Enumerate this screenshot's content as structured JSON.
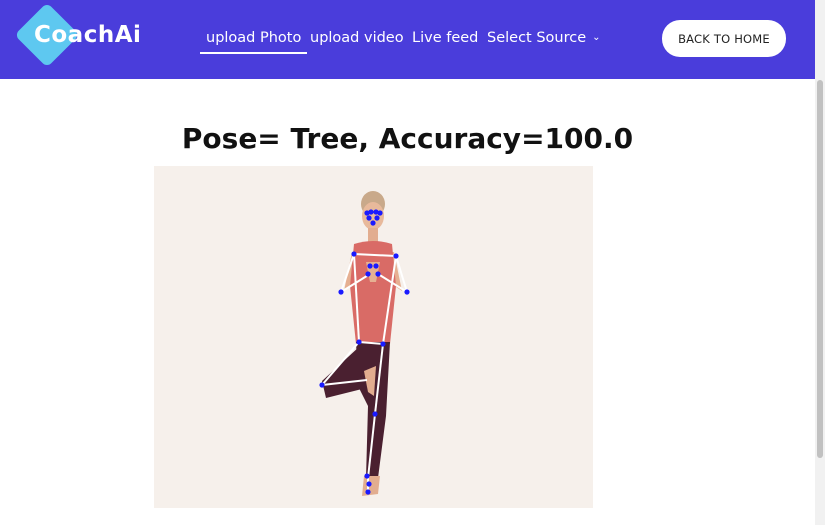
{
  "brand": {
    "name": "CoachAi"
  },
  "nav": {
    "items": [
      {
        "label": "upload Photo",
        "active": true
      },
      {
        "label": "upload video",
        "active": false
      },
      {
        "label": "Live feed",
        "active": false
      },
      {
        "label": "Select Source",
        "active": false,
        "dropdown": true
      }
    ],
    "back_button": "BACK TO HOME"
  },
  "result": {
    "title": "Pose= Tree, Accuracy=100.0"
  },
  "colors": {
    "navbar": "#4a3ddb",
    "logo_accent": "#5ec8f0",
    "keypoint": "#1a1aff",
    "skeleton": "#ffffff"
  }
}
